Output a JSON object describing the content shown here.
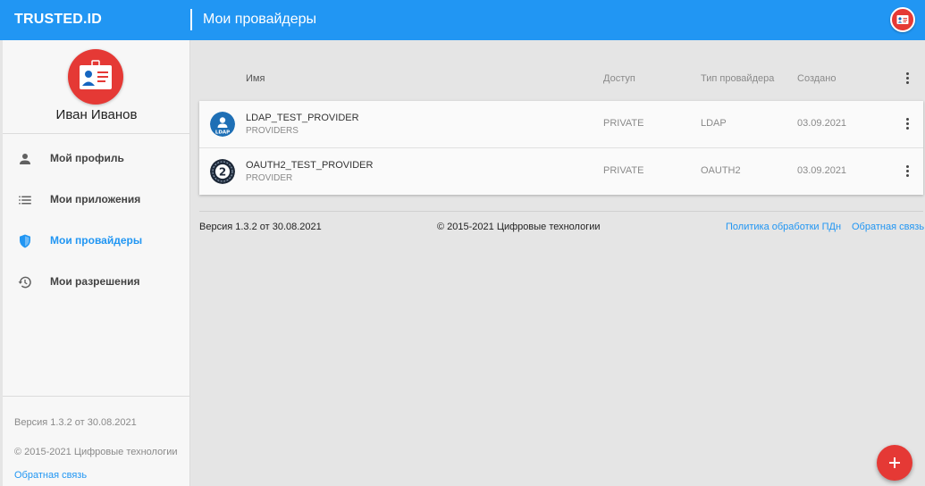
{
  "header": {
    "brand": "TRUSTED.ID",
    "title": "Мои провайдеры"
  },
  "sidebar": {
    "user_name": "Иван Иванов",
    "items": [
      {
        "label": "Мой профиль",
        "icon": "person-icon",
        "active": false
      },
      {
        "label": "Мои приложения",
        "icon": "list-icon",
        "active": false
      },
      {
        "label": "Мои провайдеры",
        "icon": "shield-icon",
        "active": true
      },
      {
        "label": "Мои разрешения",
        "icon": "history-icon",
        "active": false
      }
    ],
    "version": "Версия 1.3.2 от 30.08.2021",
    "copyright": "© 2015-2021 Цифровые технологии",
    "feedback": "Обратная связь"
  },
  "table": {
    "columns": [
      "Имя",
      "Доступ",
      "Тип провайдера",
      "Создано"
    ],
    "rows": [
      {
        "logo": "ldap-logo-icon",
        "logo_text": "LDAP",
        "name": "LDAP_TEST_PROVIDER",
        "subtitle": "PROVIDERS",
        "access": "PRIVATE",
        "type": "LDAP",
        "created": "03.09.2021"
      },
      {
        "logo": "oauth2-logo-icon",
        "logo_text": "2",
        "name": "OAUTH2_TEST_PROVIDER",
        "subtitle": "PROVIDER",
        "access": "PRIVATE",
        "type": "OAUTH2",
        "created": "03.09.2021"
      }
    ]
  },
  "footer": {
    "version": "Версия 1.3.2 от 30.08.2021",
    "copyright": "© 2015-2021 Цифровые технологии",
    "policy": "Политика обработки ПДн",
    "feedback": "Обратная связь"
  },
  "colors": {
    "primary": "#2196f3",
    "accent": "#e53935",
    "background": "#e5e5e5"
  },
  "icons": {
    "fab": "plus-icon",
    "account": "id-card-icon",
    "more": "more-vert-icon"
  }
}
